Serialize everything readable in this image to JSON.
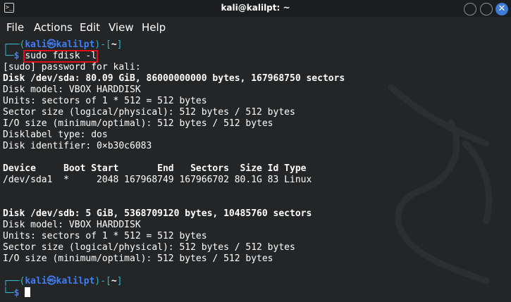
{
  "window": {
    "title": "kali@kalilpt: ~",
    "app_icon_glyph": ">_",
    "close_glyph": "✕"
  },
  "menu": {
    "file": "File",
    "actions": "Actions",
    "edit": "Edit",
    "view": "View",
    "help": "Help"
  },
  "prompt1": {
    "top_left": "┌──(",
    "user_host": "kali㉿kalilpt",
    "top_mid": ")-[",
    "path": "~",
    "top_right": "]",
    "bottom": "└─",
    "dollar": "$",
    "command": "sudo fdisk -l"
  },
  "output": {
    "sudo_prompt": "[sudo] password for kali:",
    "sda": {
      "header": "Disk /dev/sda: 80.09 GiB, 86000000000 bytes, 167968750 sectors",
      "model": "Disk model: VBOX HARDDISK",
      "units": "Units: sectors of 1 * 512 = 512 bytes",
      "sector_size": "Sector size (logical/physical): 512 bytes / 512 bytes",
      "io_size": "I/O size (minimum/optimal): 512 bytes / 512 bytes",
      "label_type": "Disklabel type: dos",
      "identifier": "Disk identifier: 0×b30c6083"
    },
    "partition_table": {
      "header": "Device     Boot Start       End   Sectors  Size Id Type",
      "rows": [
        "/dev/sda1  *     2048 167968749 167966702 80.1G 83 Linux"
      ]
    },
    "sdb": {
      "header": "Disk /dev/sdb: 5 GiB, 5368709120 bytes, 10485760 sectors",
      "model": "Disk model: VBOX HARDDISK",
      "units": "Units: sectors of 1 * 512 = 512 bytes",
      "sector_size": "Sector size (logical/physical): 512 bytes / 512 bytes",
      "io_size": "I/O size (minimum/optimal): 512 bytes / 512 bytes"
    }
  },
  "prompt2": {
    "top_left": "┌──(",
    "user_host": "kali㉿kalilpt",
    "top_mid": ")-[",
    "path": "~",
    "top_right": "]",
    "bottom": "└─",
    "dollar": "$"
  },
  "colors": {
    "background": "#232527",
    "prompt_frame": "#2fb4c8",
    "prompt_user": "#3f7ef5",
    "highlight_box": "#e0101a",
    "close_button": "#3c7bd6"
  }
}
